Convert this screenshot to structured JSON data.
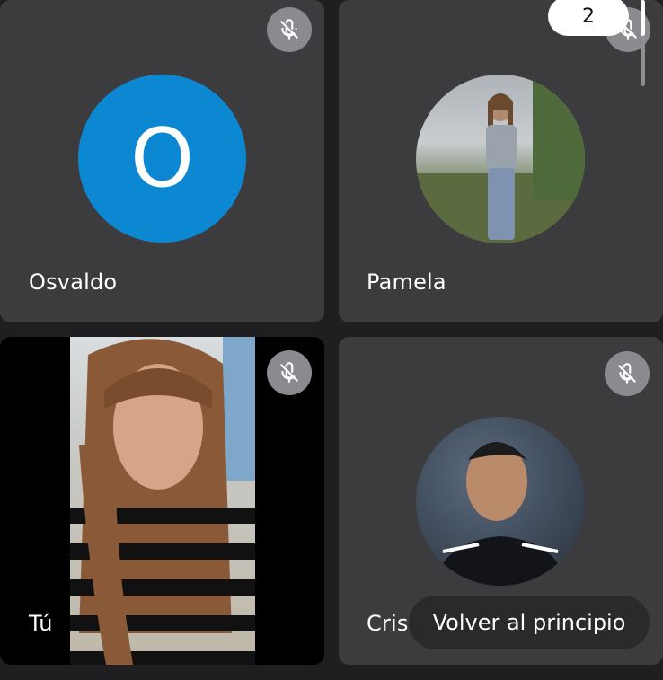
{
  "participants": [
    {
      "name": "Osvaldo",
      "avatar_letter": "O",
      "avatar_color": "#0c88d3",
      "muted": true
    },
    {
      "name": "Pamela",
      "muted": true
    },
    {
      "name": "Tú",
      "muted": true
    },
    {
      "name": "Cristi",
      "muted": true
    }
  ],
  "page_indicator": "2",
  "toast": {
    "label": "Volver al principio"
  },
  "icons": {
    "mute": "mic-off-icon"
  }
}
